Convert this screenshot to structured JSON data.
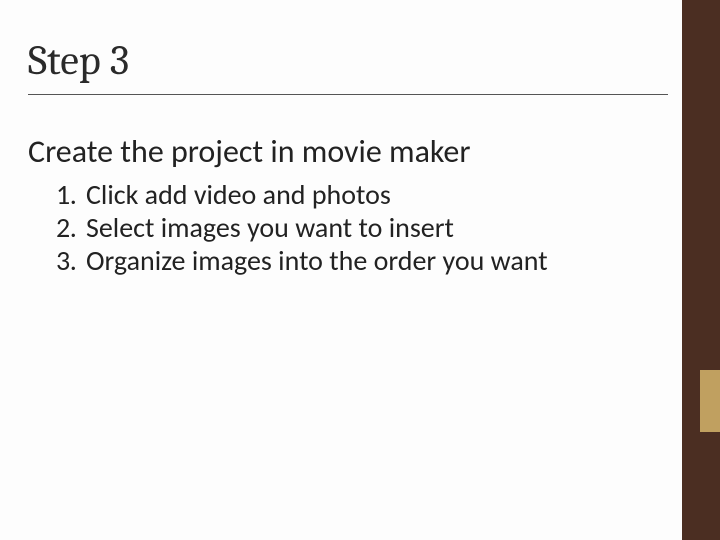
{
  "title": "Step 3",
  "subtitle": "Create the project in movie maker",
  "steps": [
    {
      "num": "1.",
      "text": "Click add video and photos"
    },
    {
      "num": "2.",
      "text": "Select images you want to insert"
    },
    {
      "num": "3.",
      "text": "Organize images into the order you want"
    }
  ],
  "colors": {
    "sidebar": "#4b2e22",
    "accent": "#c0a060"
  }
}
